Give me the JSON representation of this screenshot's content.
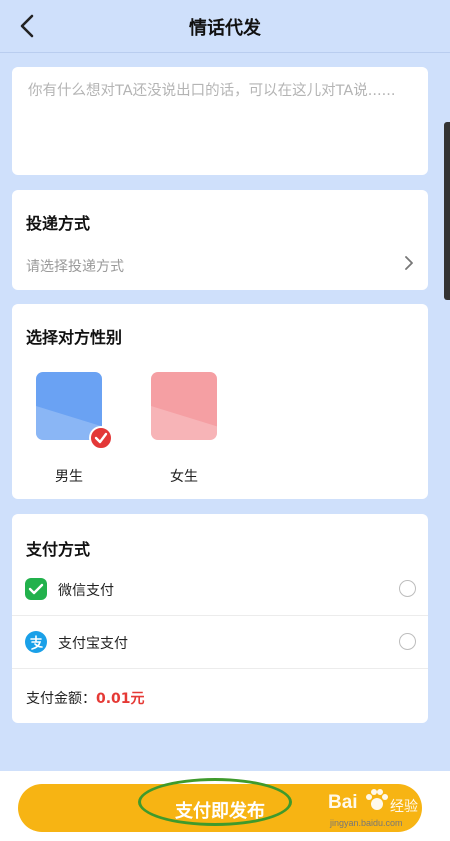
{
  "header": {
    "title": "情话代发",
    "back_icon": "chevron-left-icon"
  },
  "message": {
    "placeholder": "你有什么想对TA还没说出口的话，可以在这儿对TA说......",
    "value": ""
  },
  "delivery": {
    "title": "投递方式",
    "placeholder": "请选择投递方式",
    "chevron_icon": "chevron-right-icon"
  },
  "gender": {
    "title": "选择对方性别",
    "options": [
      {
        "label": "男生",
        "color": "#6aa2f3",
        "selected": true
      },
      {
        "label": "女生",
        "color": "#f59fa3",
        "selected": false
      }
    ],
    "check_icon": "check-badge-icon",
    "check_color": "#e33838"
  },
  "payment": {
    "title": "支付方式",
    "methods": [
      {
        "label": "微信支付",
        "icon": "wechat-pay-icon",
        "color": "#22b14c",
        "selected": false
      },
      {
        "label": "支付宝支付",
        "icon": "alipay-icon",
        "color": "#1aa0e8",
        "selected": false
      }
    ],
    "amount_label": "支付金额：",
    "amount_value": "0.01元",
    "amount_color": "#e53935"
  },
  "footer": {
    "submit_label": "支付即发布",
    "button_color": "#f7b413"
  },
  "watermark": {
    "brand": "Bai",
    "brand_suffix": "经验",
    "url": "jingyan.baidu.com"
  },
  "colors": {
    "background": "#cfe0fb",
    "annotation_ring": "#3f9a2c"
  }
}
